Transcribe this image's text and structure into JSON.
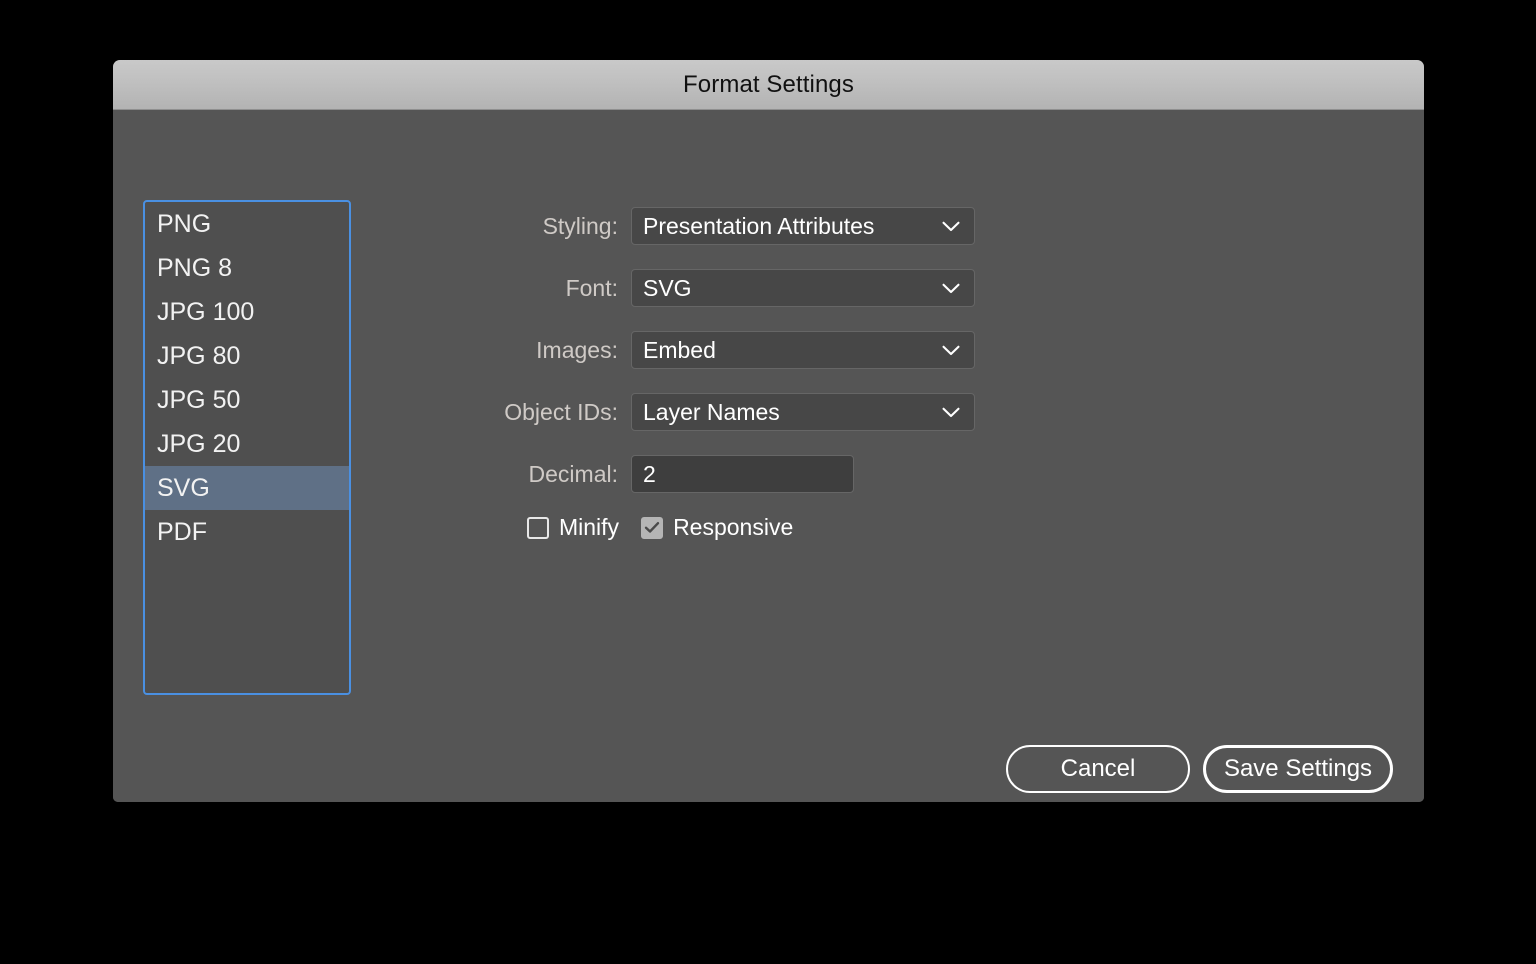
{
  "window": {
    "title": "Format Settings"
  },
  "format_list": {
    "name": "format-presets",
    "selected": "SVG",
    "items": [
      {
        "label": "PNG"
      },
      {
        "label": "PNG 8"
      },
      {
        "label": "JPG 100"
      },
      {
        "label": "JPG 80"
      },
      {
        "label": "JPG 50"
      },
      {
        "label": "JPG 20"
      },
      {
        "label": "SVG"
      },
      {
        "label": "PDF"
      }
    ]
  },
  "form": {
    "styling": {
      "label": "Styling:",
      "value": "Presentation Attributes",
      "icon": "chevron-down-icon"
    },
    "font": {
      "label": "Font:",
      "value": "SVG",
      "icon": "chevron-down-icon"
    },
    "images": {
      "label": "Images:",
      "value": "Embed",
      "icon": "chevron-down-icon"
    },
    "object_ids": {
      "label": "Object IDs:",
      "value": "Layer Names",
      "icon": "chevron-down-icon"
    },
    "decimal": {
      "label": "Decimal:",
      "value": "2"
    },
    "checkboxes": {
      "minify": {
        "label": "Minify",
        "checked": "false"
      },
      "responsive": {
        "label": "Responsive",
        "checked": "true"
      }
    }
  },
  "buttons": {
    "cancel": "Cancel",
    "save": "Save Settings"
  },
  "colors": {
    "dialog_body": "#555555",
    "titlebar": "#bfbfbf",
    "accent_focus": "#4a90e2",
    "selection": "#5f7086",
    "field_bg": "#474747",
    "text": "#ffffff",
    "label_text": "#cfcac6"
  }
}
